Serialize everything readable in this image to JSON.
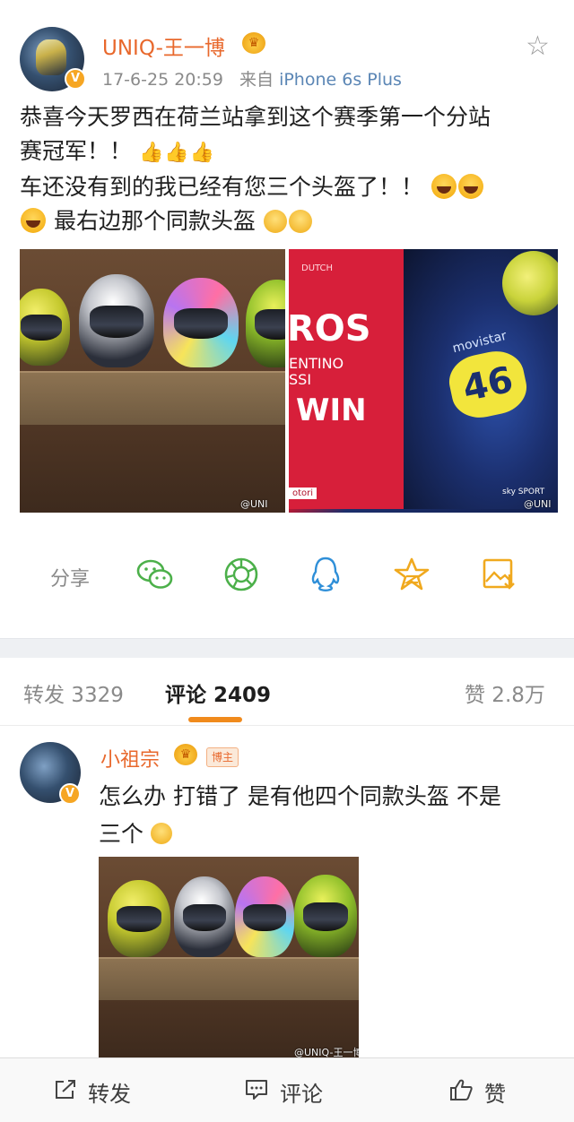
{
  "post": {
    "username": "UNIQ-王一博",
    "verified_badge": "V",
    "time": "17-6-25 20:59",
    "source_prefix": "来自",
    "source": "iPhone 6s Plus",
    "text_line1": "恭喜今天罗西在荷兰站拿到这个赛季第一个分站",
    "text_line2": "赛冠军！！",
    "text_line3": "车还没有到的我已经有您三个头盔了！！",
    "text_line4": "最右边那个同款头盔",
    "thumbs_emoji": "👍👍👍",
    "icons": {
      "favorite": "star-outline-icon",
      "verified": "verified-v-badge-icon",
      "crown": "vip-crown-icon"
    },
    "photo_left_watermark": "@UNI",
    "photo_right": {
      "dutch": "DUTCH",
      "ross": "ROS",
      "line_ntino": "ENTINO",
      "line_ssi": "SSI",
      "win": "WIN",
      "motori": "otori",
      "sky": "sky SPORT",
      "watermark": "@UNI",
      "movistar": "movistar"
    }
  },
  "share": {
    "label": "分享",
    "icons": [
      "wechat-icon",
      "moments-icon",
      "qq-icon",
      "qzone-icon",
      "save-image-icon"
    ],
    "colors": {
      "green": "#4cb04a",
      "blue": "#2f8fd8",
      "gold": "#f0a91e"
    }
  },
  "tabs": {
    "repost": "转发 3329",
    "comments": "评论 2409",
    "likes": "赞 2.8万"
  },
  "comment": {
    "username": "小祖宗",
    "host_badge": "博主",
    "text_line1": "怎么办 打错了 是有他四个同款头盔 不是",
    "text_line2": "三个",
    "photo_watermark": "@UNIQ-王一博"
  },
  "bottom_bar": {
    "repost": "转发",
    "comment": "评论",
    "like": "赞"
  }
}
